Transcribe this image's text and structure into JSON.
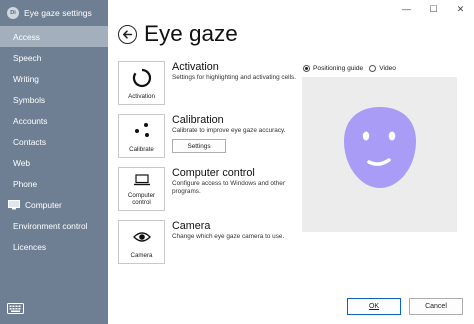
{
  "window": {
    "title": "Eye gaze settings",
    "logo_text": "Di",
    "minimize": "—",
    "maximize": "☐",
    "close": "✕"
  },
  "sidebar": {
    "items": [
      {
        "label": "Access",
        "active": true
      },
      {
        "label": "Speech"
      },
      {
        "label": "Writing"
      },
      {
        "label": "Symbols"
      },
      {
        "label": "Accounts"
      },
      {
        "label": "Contacts"
      },
      {
        "label": "Web"
      },
      {
        "label": "Phone"
      },
      {
        "label": "Computer",
        "icon": "computer-icon"
      },
      {
        "label": "Environment control"
      },
      {
        "label": "Licences"
      }
    ],
    "footer_icon": "keyboard-icon"
  },
  "page": {
    "title": "Eye gaze",
    "back_icon": "back-arrow-icon"
  },
  "features": [
    {
      "tile": "Activation",
      "icon": "activation-ring-icon",
      "title": "Activation",
      "desc": "Settings for highlighting and activating cells."
    },
    {
      "tile": "Calibrate",
      "icon": "calibration-dots-icon",
      "title": "Calibration",
      "desc": "Calibrate to improve eye gaze accuracy.",
      "button": "Settings"
    },
    {
      "tile": "Computer control",
      "icon": "laptop-icon",
      "title": "Computer control",
      "desc": "Configure access to Windows and other programs."
    },
    {
      "tile": "Camera",
      "icon": "eye-icon",
      "title": "Camera",
      "desc": "Change which eye gaze camera to use."
    }
  ],
  "preview": {
    "options": [
      "Positioning guide",
      "Video"
    ],
    "selected": "Positioning guide",
    "face_color": "#a99cf7",
    "face_icon": "face-icon"
  },
  "footer": {
    "ok": "OK",
    "cancel": "Cancel"
  }
}
